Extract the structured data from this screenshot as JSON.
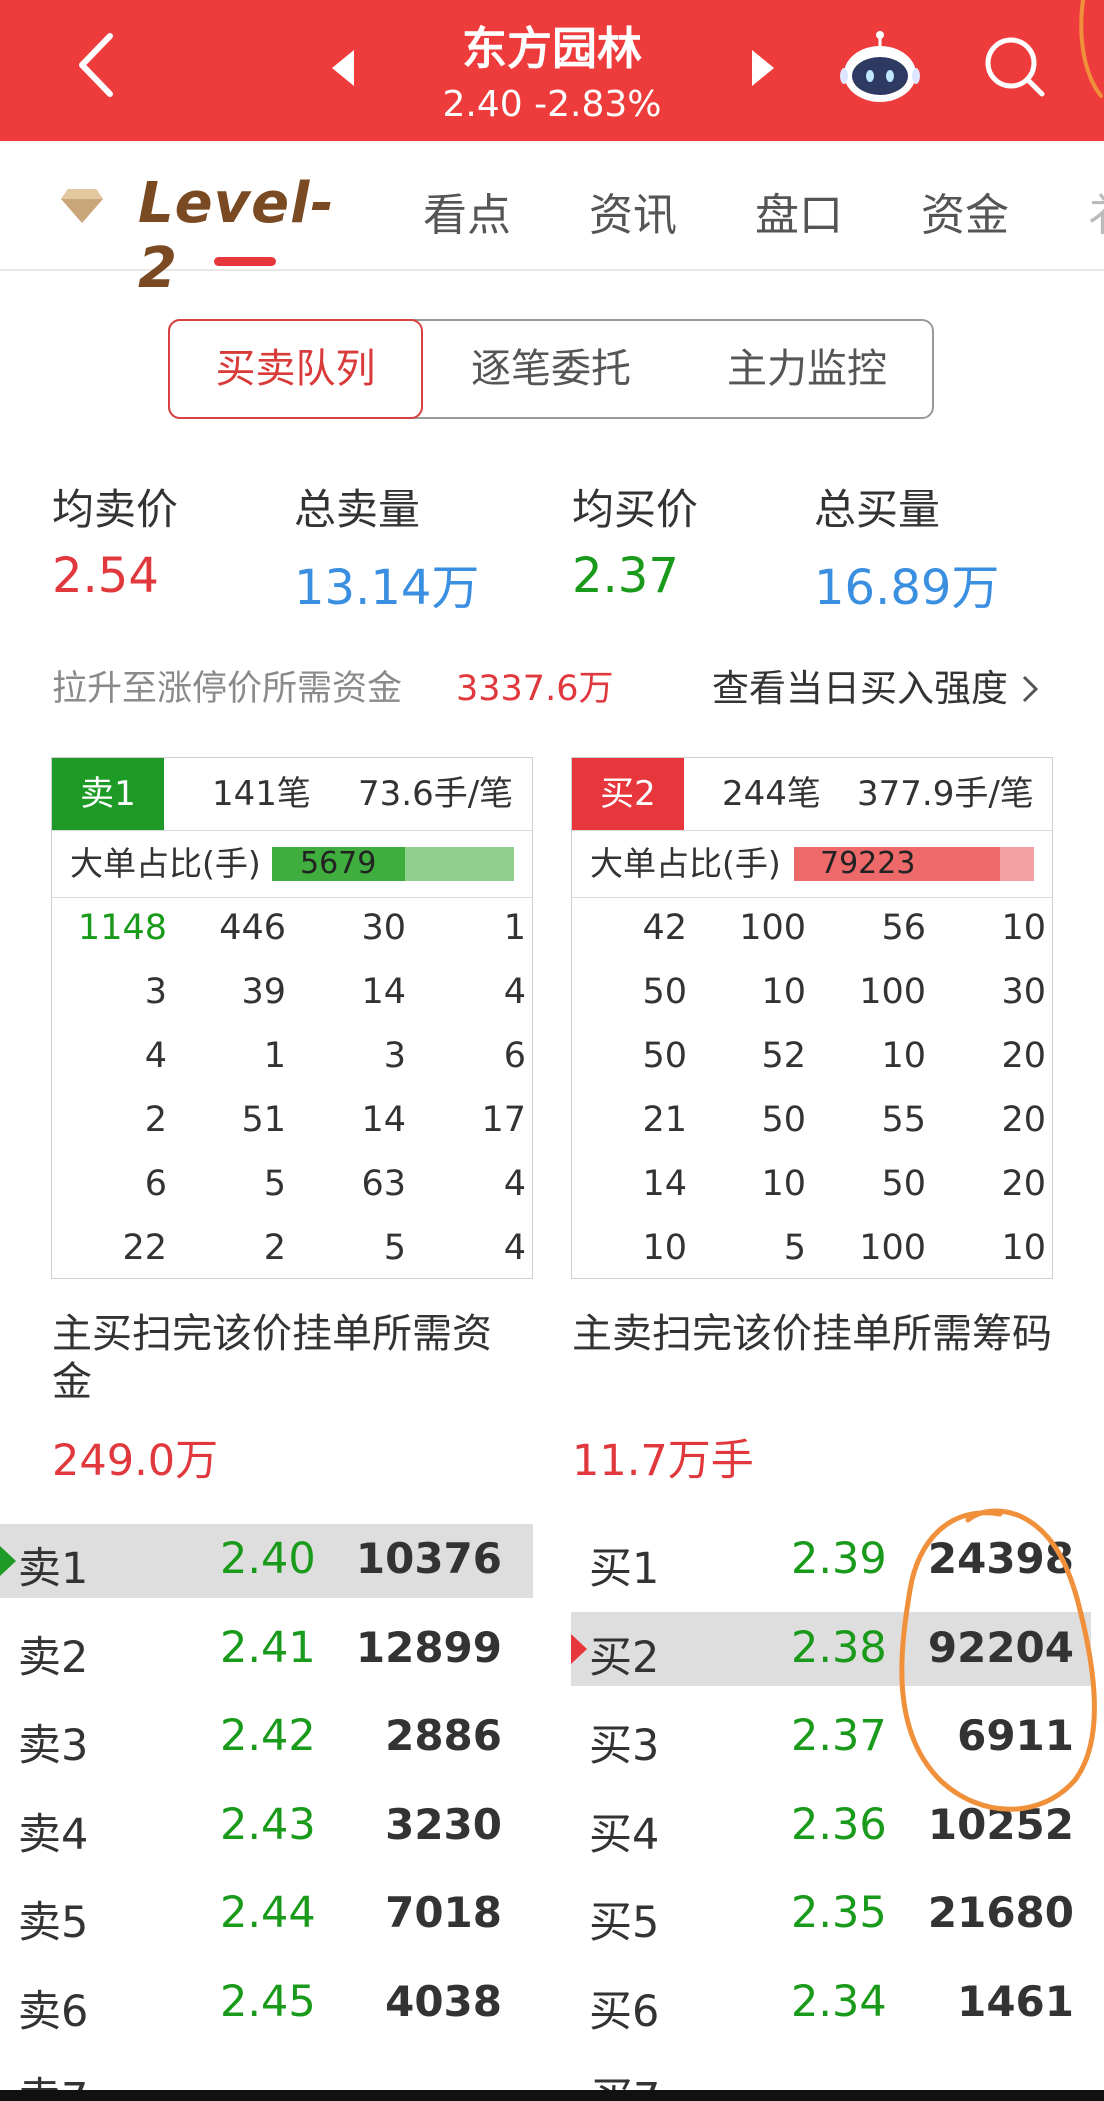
{
  "header": {
    "title": "东方园林",
    "price": "2.40",
    "change": "-2.83%"
  },
  "tabs": {
    "level2": "Level-2",
    "items": [
      "看点",
      "资讯",
      "盘口",
      "资金"
    ]
  },
  "segments": [
    "买卖队列",
    "逐笔委托",
    "主力监控"
  ],
  "summary": {
    "avg_sell_label": "均卖价",
    "avg_sell_value": "2.54",
    "total_sell_label": "总卖量",
    "total_sell_value": "13.14万",
    "avg_buy_label": "均买价",
    "avg_buy_value": "2.37",
    "total_buy_label": "总买量",
    "total_buy_value": "16.89万"
  },
  "limit_up": {
    "label": "拉升至涨停价所需资金",
    "value": "3337.6万",
    "link": "查看当日买入强度"
  },
  "sell_queue": {
    "tag": "卖1",
    "count": "141笔",
    "avg": "73.6手/笔",
    "big_label": "大单占比(手)",
    "big_value": "5679",
    "big_fraction": 0.55,
    "rows": [
      [
        "1148",
        "446",
        "30",
        "1"
      ],
      [
        "3",
        "39",
        "14",
        "4"
      ],
      [
        "4",
        "1",
        "3",
        "6"
      ],
      [
        "2",
        "51",
        "14",
        "17"
      ],
      [
        "6",
        "5",
        "63",
        "4"
      ],
      [
        "22",
        "2",
        "5",
        "4"
      ]
    ],
    "note": "主买扫完该价挂单所需资金",
    "note_value": "249.0万"
  },
  "buy_queue": {
    "tag": "买2",
    "count": "244笔",
    "avg": "377.9手/笔",
    "big_label": "大单占比(手)",
    "big_value": "79223",
    "big_fraction": 0.86,
    "rows": [
      [
        "42",
        "100",
        "56",
        "10"
      ],
      [
        "50",
        "10",
        "100",
        "30"
      ],
      [
        "50",
        "52",
        "10",
        "20"
      ],
      [
        "21",
        "50",
        "55",
        "20"
      ],
      [
        "14",
        "10",
        "50",
        "20"
      ],
      [
        "10",
        "5",
        "100",
        "10"
      ]
    ],
    "note": "主卖扫完该价挂单所需筹码",
    "note_value": "11.7万手"
  },
  "order_book": {
    "sells": [
      {
        "label": "卖1",
        "price": "2.40",
        "vol": "10376"
      },
      {
        "label": "卖2",
        "price": "2.41",
        "vol": "12899"
      },
      {
        "label": "卖3",
        "price": "2.42",
        "vol": "2886"
      },
      {
        "label": "卖4",
        "price": "2.43",
        "vol": "3230"
      },
      {
        "label": "卖5",
        "price": "2.44",
        "vol": "7018"
      },
      {
        "label": "卖6",
        "price": "2.45",
        "vol": "4038"
      }
    ],
    "buys": [
      {
        "label": "买1",
        "price": "2.39",
        "vol": "24398"
      },
      {
        "label": "买2",
        "price": "2.38",
        "vol": "92204"
      },
      {
        "label": "买3",
        "price": "2.37",
        "vol": "6911"
      },
      {
        "label": "买4",
        "price": "2.36",
        "vol": "10252"
      },
      {
        "label": "买5",
        "price": "2.35",
        "vol": "21680"
      },
      {
        "label": "买6",
        "price": "2.34",
        "vol": "1461"
      }
    ]
  },
  "colors": {
    "header_red": "#ee3c3c",
    "price_green": "#1a9a1a",
    "annotation_orange": "#f0903a"
  }
}
